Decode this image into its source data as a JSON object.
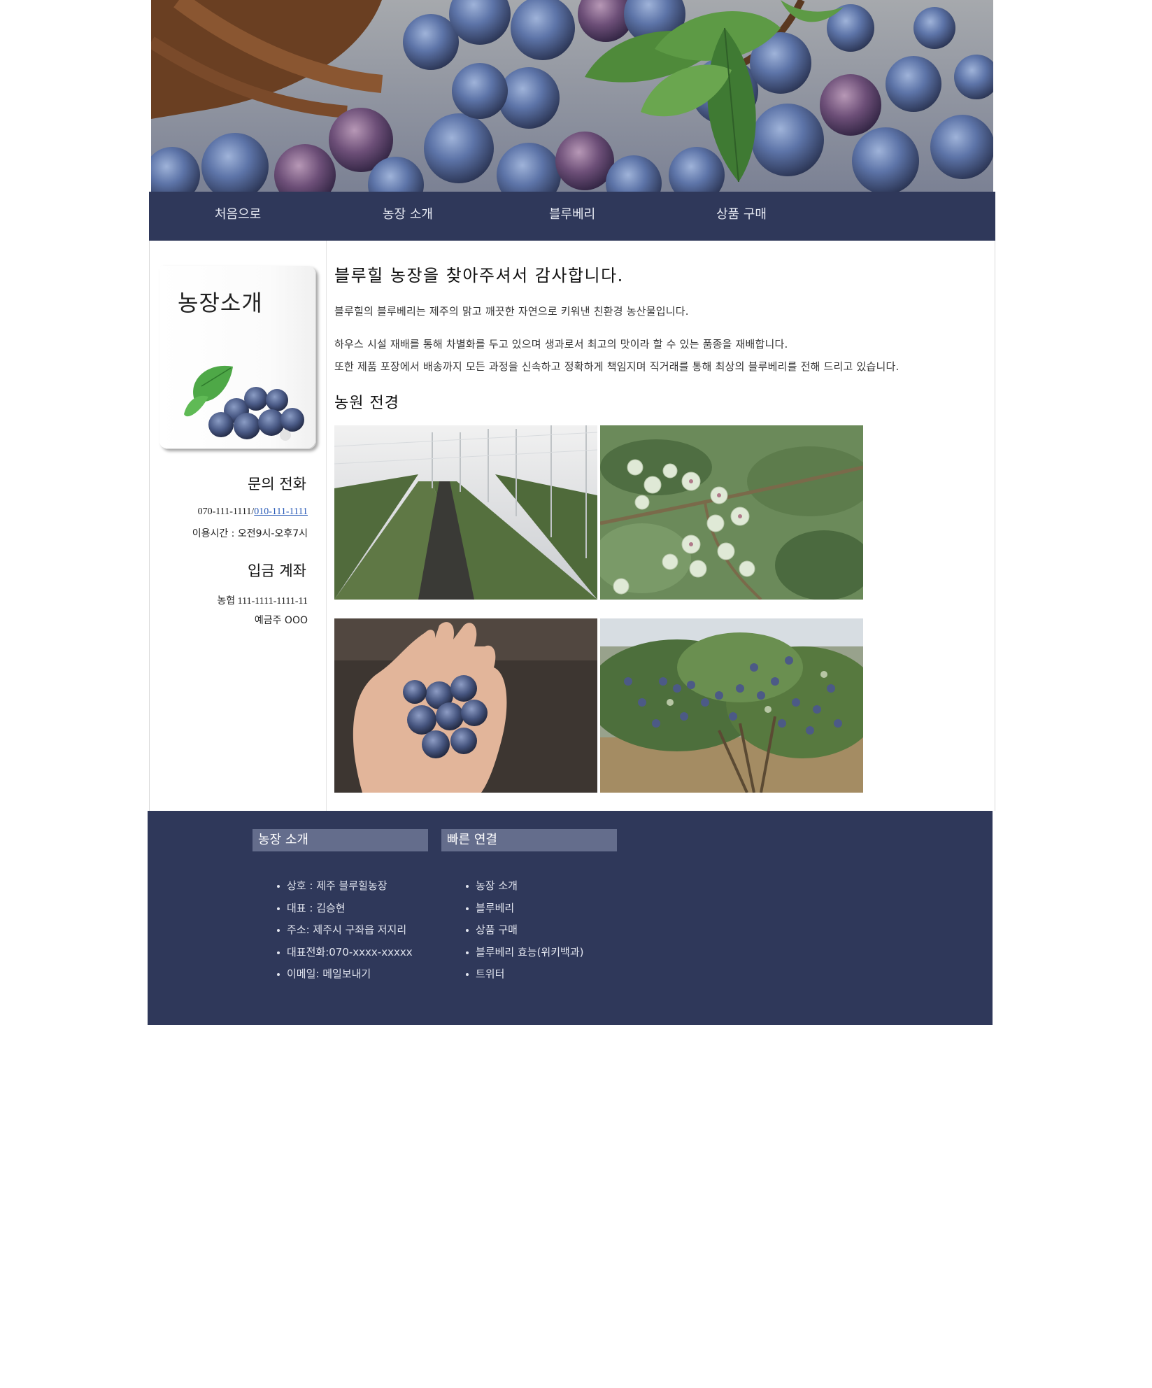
{
  "nav": {
    "items": [
      "처음으로",
      "농장 소개",
      "블루베리",
      "상품 구매"
    ]
  },
  "sidebar": {
    "card_title": "농장소개",
    "phone_heading": "문의 전화",
    "phone_primary": "070-111-1111/",
    "phone_secondary": "010-111-1111",
    "hours": "이용시간 : 오전9시-오후7시",
    "account_heading": "입금 계좌",
    "account_number": "농협 111-1111-1111-11",
    "account_holder": "예금주 OOO"
  },
  "content": {
    "title": "블루힐 농장을 찾아주셔서 감사합니다.",
    "para1": "블루힐의 블루베리는 제주의 맑고 깨끗한 자연으로 키워낸 친환경 농산물입니다.",
    "para2": "하우스 시설 재배를 통해 차별화를 두고 있으며 생과로서 최고의 맛이라 할 수 있는 품종을 재배합니다.",
    "para3": "또한 제품 포장에서 배송까지 모든 과정을 신속하고 정확하게 책임지며 직거래를 통해 최상의 블루베리를 전해 드리고 있습니다.",
    "gallery_title": "농원 전경"
  },
  "footer": {
    "about_heading": "농장 소개",
    "about_items": [
      "상호 : 제주 블루힐농장",
      "대표 : 김승현",
      "주소: 제주시 구좌읍 저지리",
      "대표전화:070-xxxx-xxxxx",
      "이메일: 메일보내기"
    ],
    "links_heading": "빠른 연결",
    "links_items": [
      "농장 소개",
      "블루베리",
      "상품 구매",
      "블루베리 효능(위키백과)",
      "트위터"
    ]
  },
  "colors": {
    "nav_bg": "#2f385a",
    "footer_bg": "#2f385a",
    "footer_heading_bg": "#646d8c",
    "link": "#2b5cb8"
  }
}
